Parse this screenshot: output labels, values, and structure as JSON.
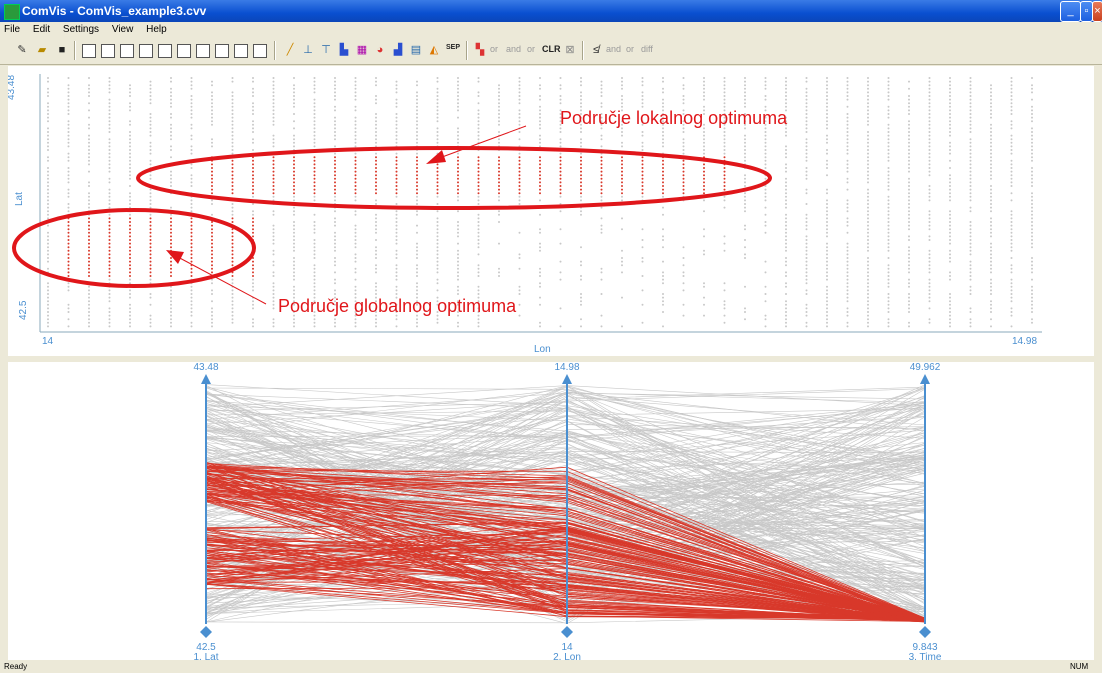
{
  "window": {
    "title": "ComVis - ComVis_example3.cvv"
  },
  "menu": [
    "File",
    "Edit",
    "Settings",
    "View",
    "Help"
  ],
  "toolbar": {
    "or1": "or",
    "and1": "and",
    "or2": "or",
    "clr": "CLR",
    "and2": "and",
    "or3": "or",
    "diff": "diff",
    "sep": "SEP"
  },
  "scatter": {
    "ylabel": "Lat",
    "xlabel": "Lon",
    "ymax_label": "43.48",
    "ymin_label": "42.5",
    "xmin_label": "14",
    "xmax_label": "14.98",
    "annotation_local": "Područje lokalnog optimuma",
    "annotation_global": "Područje globalnog optimuma"
  },
  "parallel": {
    "axes": [
      {
        "name": "1. Lat",
        "max": "43.48",
        "min": "42.5"
      },
      {
        "name": "2. Lon",
        "max": "14.98",
        "min": "14"
      },
      {
        "name": "3. Time",
        "max": "49.962",
        "min": "9.843"
      }
    ]
  },
  "status": {
    "left": "Ready",
    "right": "NUM"
  },
  "colors": {
    "highlight": "#d8392b",
    "unselected": "#c8c8c8",
    "axis": "#4a8fd0"
  }
}
